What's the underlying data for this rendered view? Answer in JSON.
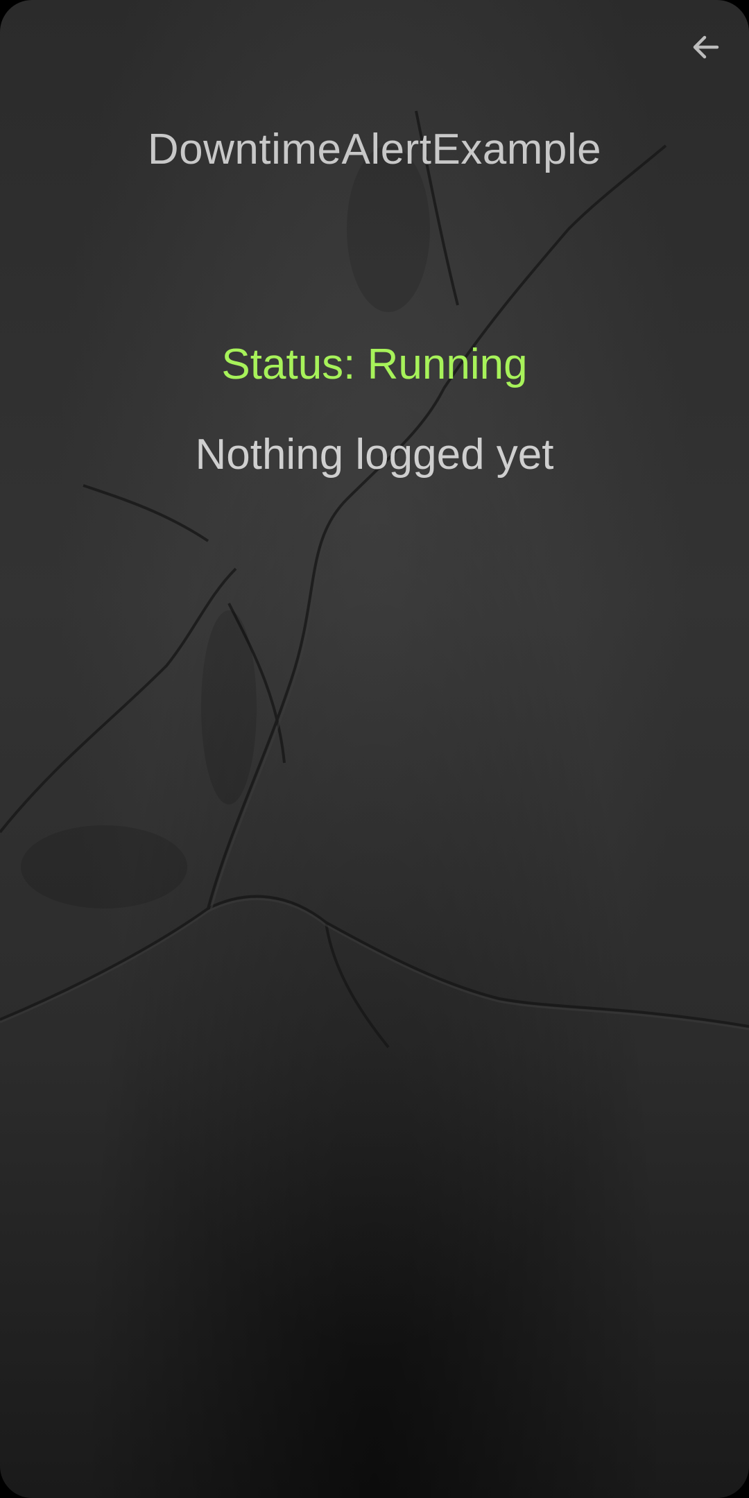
{
  "app": {
    "title": "DowntimeAlertExample"
  },
  "toolbar": {
    "back_icon": "arrow-left-icon"
  },
  "status": {
    "text": "Status: Running",
    "color": "#a7f25a"
  },
  "log": {
    "text": "Nothing logged yet"
  },
  "theme": {
    "background": "#2c2c2c",
    "text_color": "#c8c8c8"
  }
}
